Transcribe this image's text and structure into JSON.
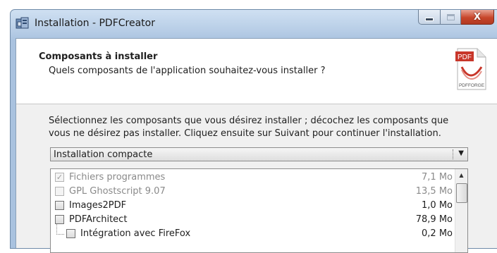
{
  "window": {
    "title": "Installation - PDFCreator",
    "minimize_glyph": "",
    "close_glyph": "X"
  },
  "header": {
    "title": "Composants à installer",
    "subtitle": "Quels composants de l'application souhaitez-vous installer ?",
    "logo_text_top": "PDF",
    "logo_text_bottom": "PDFFORGE"
  },
  "description": "Sélectionnez les composants que vous désirez installer ; décochez les composants que vous ne désirez pas installer. Cliquez ensuite sur Suivant pour continuer l'installation.",
  "install_type": {
    "selected": "Installation compacte"
  },
  "components": [
    {
      "label": "Fichiers programmes",
      "size": "7,1 Mo",
      "checked": true,
      "disabled": true
    },
    {
      "label": "GPL Ghostscript 9.07",
      "size": "13,5 Mo",
      "checked": false,
      "disabled": true
    },
    {
      "label": "Images2PDF",
      "size": "1,0 Mo",
      "checked": false,
      "disabled": false
    },
    {
      "label": "PDFArchitect",
      "size": "78,9 Mo",
      "checked": false,
      "disabled": false
    },
    {
      "label": "Intégration avec FireFox",
      "size": "0,2 Mo",
      "checked": false,
      "disabled": false,
      "child": true
    }
  ],
  "icons": {
    "app": "installer-icon",
    "checkmark": "✓",
    "dropdown": "▼",
    "scroll_up": "▲"
  },
  "colors": {
    "titlebar": "#b7cde6",
    "close_button": "#c7462b",
    "logo_red": "#c8362a"
  }
}
